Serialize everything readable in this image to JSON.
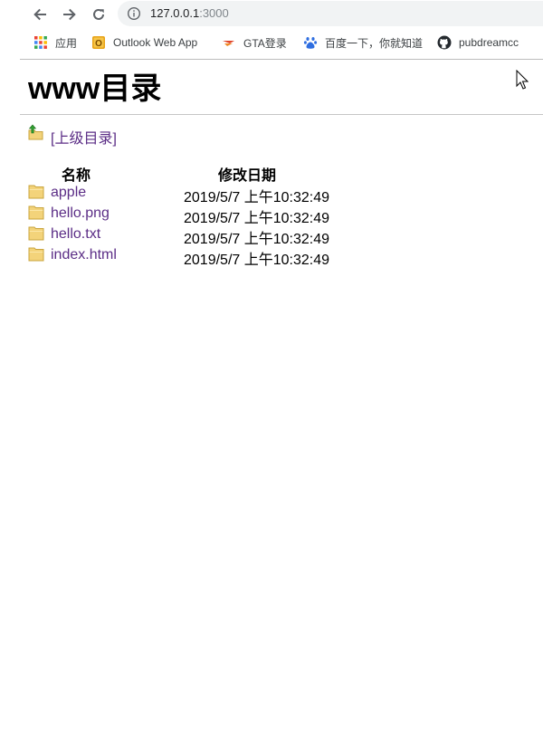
{
  "browser": {
    "url_host": "127.0.0.1",
    "url_port": ":3000",
    "bookmarks": [
      {
        "label": "应用",
        "icon": "apps-grid-icon"
      },
      {
        "label": "Outlook Web App",
        "icon": "outlook-icon"
      },
      {
        "label": "GTA登录",
        "icon": "gta-icon"
      },
      {
        "label": "百度一下，你就知道",
        "icon": "baidu-paw-icon"
      },
      {
        "label": "pubdreamcc",
        "icon": "github-icon"
      }
    ]
  },
  "page": {
    "title": "www目录",
    "parent_link": "[上级目录]",
    "columns": {
      "name": "名称",
      "modified": "修改日期"
    },
    "files": [
      {
        "name": "apple",
        "modified": "2019/5/7 上午10:32:49"
      },
      {
        "name": "hello.png",
        "modified": "2019/5/7 上午10:32:49"
      },
      {
        "name": "hello.txt",
        "modified": "2019/5/7 上午10:32:49"
      },
      {
        "name": "index.html",
        "modified": "2019/5/7 上午10:32:49"
      }
    ]
  },
  "colors": {
    "link": "#5b2d86",
    "omnibox_bg": "#f1f3f4",
    "folder_yellow": "#f3d37a"
  }
}
